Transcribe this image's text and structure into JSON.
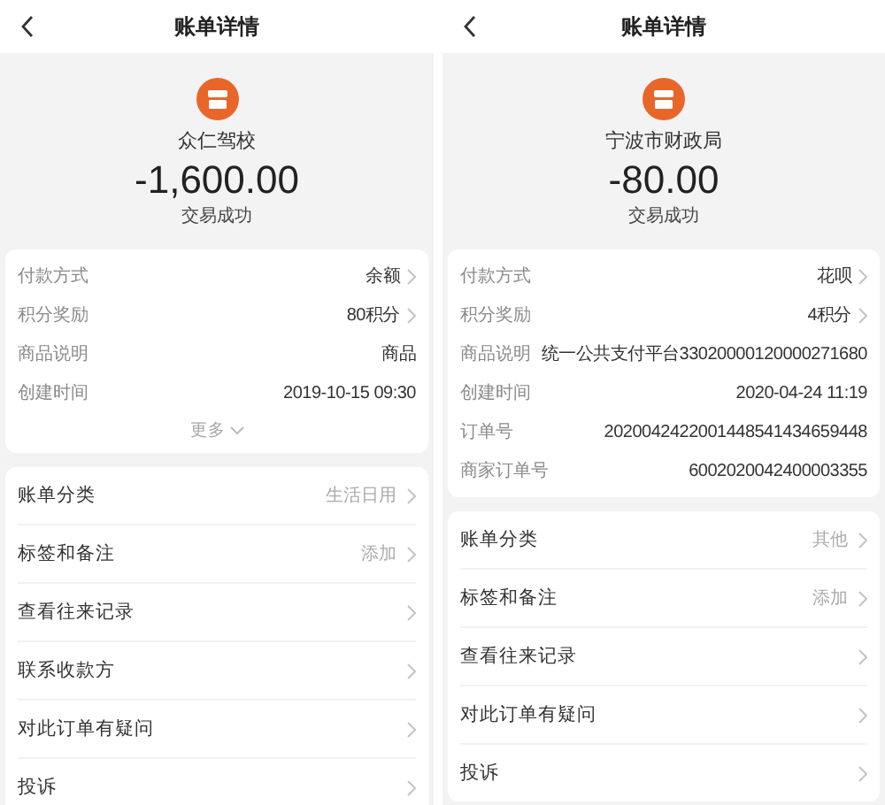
{
  "panels": [
    {
      "title": "账单详情",
      "merchant": "众仁驾校",
      "amount": "-1,600.00",
      "status": "交易成功",
      "details": [
        {
          "label": "付款方式",
          "value": "余额",
          "chevron": true
        },
        {
          "label": "积分奖励",
          "value": "80积分",
          "chevron": true
        },
        {
          "label": "商品说明",
          "value": "商品",
          "chevron": false
        },
        {
          "label": "创建时间",
          "value": "2019-10-15 09:30",
          "chevron": false
        }
      ],
      "more": "更多",
      "menu": [
        {
          "label": "账单分类",
          "value": "生活日用"
        },
        {
          "label": "标签和备注",
          "value": "添加"
        },
        {
          "label": "查看往来记录"
        },
        {
          "label": "联系收款方"
        },
        {
          "label": "对此订单有疑问"
        },
        {
          "label": "投诉"
        }
      ]
    },
    {
      "title": "账单详情",
      "merchant": "宁波市财政局",
      "amount": "-80.00",
      "status": "交易成功",
      "details": [
        {
          "label": "付款方式",
          "value": "花呗",
          "chevron": true
        },
        {
          "label": "积分奖励",
          "value": "4积分",
          "chevron": true
        },
        {
          "label": "商品说明",
          "value": "统一公共支付平台33020000120000271680",
          "chevron": false
        },
        {
          "label": "创建时间",
          "value": "2020-04-24 11:19",
          "chevron": false
        },
        {
          "label": "订单号",
          "value": "2020042422001448541434659448",
          "chevron": false
        },
        {
          "label": "商家订单号",
          "value": "6002020042400003355",
          "chevron": false
        }
      ],
      "menu": [
        {
          "label": "账单分类",
          "value": "其他"
        },
        {
          "label": "标签和备注",
          "value": "添加"
        },
        {
          "label": "查看往来记录"
        },
        {
          "label": "对此订单有疑问"
        },
        {
          "label": "投诉"
        }
      ]
    }
  ]
}
